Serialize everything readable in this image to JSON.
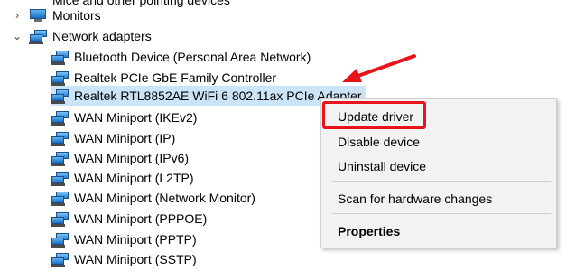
{
  "tree": {
    "partial_label": "Mice and other pointing devices",
    "categories": [
      {
        "label": "Monitors",
        "expanded": false,
        "icon": "monitor-icon"
      },
      {
        "label": "Network adapters",
        "expanded": true,
        "icon": "network-adapter-icon"
      }
    ],
    "devices": [
      {
        "label": "Bluetooth Device (Personal Area Network)"
      },
      {
        "label": "Realtek PCIe GbE Family Controller"
      },
      {
        "label": "Realtek RTL8852AE WiFi 6 802.11ax PCIe Adapter",
        "selected": true
      },
      {
        "label": "WAN Miniport (IKEv2)"
      },
      {
        "label": "WAN Miniport (IP)"
      },
      {
        "label": "WAN Miniport (IPv6)"
      },
      {
        "label": "WAN Miniport (L2TP)"
      },
      {
        "label": "WAN Miniport (Network Monitor)"
      },
      {
        "label": "WAN Miniport (PPPOE)"
      },
      {
        "label": "WAN Miniport (PPTP)"
      },
      {
        "label": "WAN Miniport (SSTP)"
      }
    ]
  },
  "context_menu": {
    "items": [
      {
        "label": "Update driver",
        "highlighted": true
      },
      {
        "label": "Disable device"
      },
      {
        "label": "Uninstall device"
      },
      {
        "label": "Scan for hardware changes"
      },
      {
        "label": "Properties",
        "bold": true
      }
    ]
  },
  "colors": {
    "selection": "#cce4f7",
    "annotation": "#e8141c",
    "menu_background": "#f2f2f2"
  }
}
